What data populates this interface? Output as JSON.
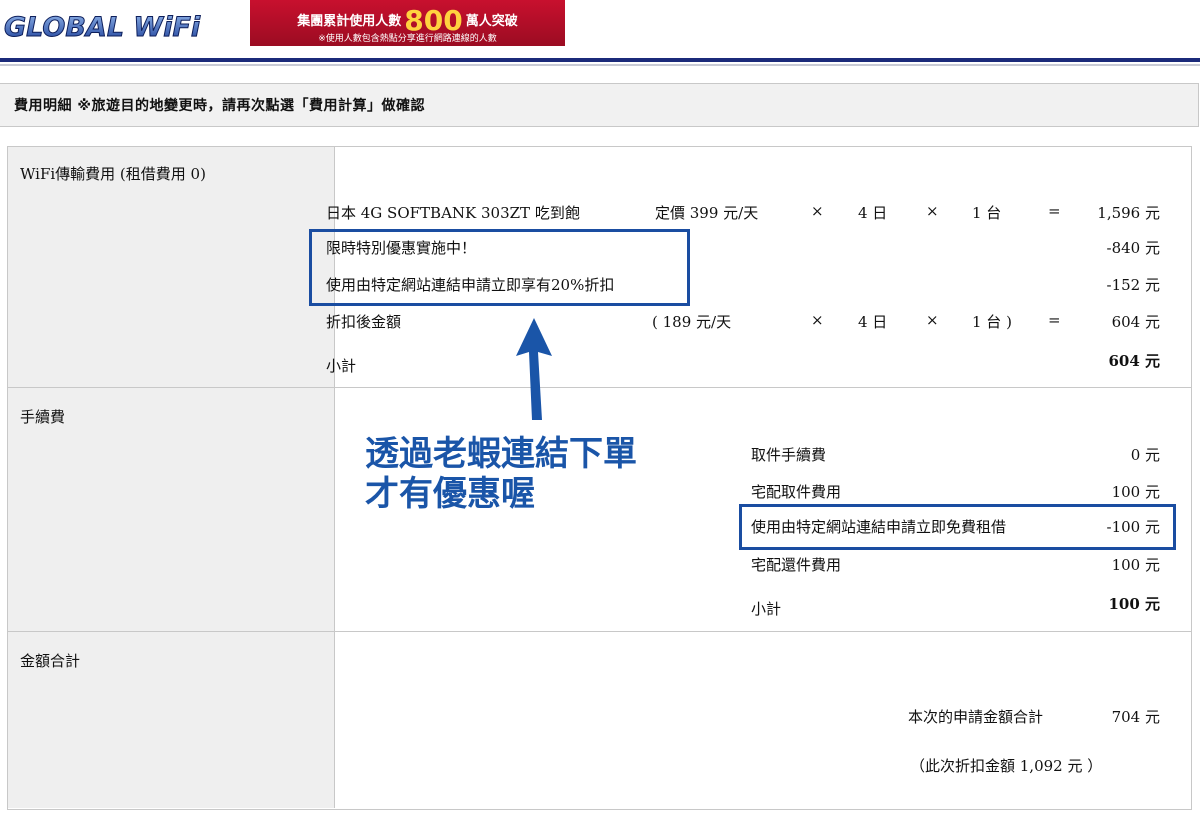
{
  "header": {
    "logo_text": "GLOBAL WiFi",
    "banner_prefix": "集團累計使用人數",
    "banner_number": "800",
    "banner_suffix": "萬人突破",
    "banner_note": "※使用人數包含熱點分享進行網路連線的人數"
  },
  "section_title": "費用明細 ※旅遊目的地變更時，請再次點選「費用計算」做確認",
  "wifi": {
    "label": "WiFi傳輸費用 (租借費用 0)",
    "product": "日本 4G SOFTBANK 303ZT 吃到飽",
    "list_price": "定價 399 元/天",
    "times1": "×",
    "days": "4 日",
    "times2": "×",
    "units": "1 台",
    "equals": "=",
    "amount": "1,596 元",
    "promo_label": "限時特別優惠實施中！",
    "promo_amount": "-840 元",
    "site_discount_label": "使用由特定網站連結申請立即享有20%折扣",
    "site_discount_amount": "-152 元",
    "after_label": "折扣後金額",
    "after_price": "( 189 元/天",
    "after_times1": "×",
    "after_days": "4 日",
    "after_times2": "×",
    "after_units": "1 台 )",
    "after_equals": "=",
    "after_amount": "604 元",
    "subtotal_label": "小計",
    "subtotal_amount": "604 元"
  },
  "fees": {
    "label": "手續費",
    "pickup_label": "取件手續費",
    "pickup_amount": "0 元",
    "delivery_label": "宅配取件費用",
    "delivery_amount": "100 元",
    "free_label": "使用由特定網站連結申請立即免費租借",
    "free_amount": "-100 元",
    "return_label": "宅配還件費用",
    "return_amount": "100 元",
    "subtotal_label": "小計",
    "subtotal_amount": "100 元"
  },
  "total": {
    "label": "金額合計",
    "apply_label": "本次的申請金額合計",
    "apply_amount": "704 元",
    "discount_note": "（此次折扣金額 1,092 元 ）"
  },
  "annotation": {
    "line1": "透過老蝦連結下單",
    "line2": "才有優惠喔"
  },
  "colors": {
    "annotation_blue": "#1a55a8",
    "header_navy": "#1b2a7a",
    "banner_red": "#c8102e",
    "banner_number": "#ffd23f"
  }
}
